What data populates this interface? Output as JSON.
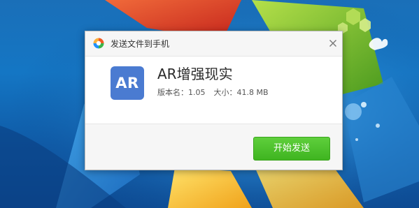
{
  "desktop": {
    "wallpaper": "windows-7-default"
  },
  "dialog": {
    "title": "发送文件到手机",
    "logo_icon": "360-logo-icon",
    "close_icon": "close-icon"
  },
  "app": {
    "icon_text": "AR",
    "icon_color": "#4a7bd1",
    "name": "AR增强现实",
    "version_label": "版本名：1.05",
    "size_label": "大小：41.8 MB"
  },
  "actions": {
    "send_label": "开始发送",
    "send_color": "#4cbf2a"
  }
}
